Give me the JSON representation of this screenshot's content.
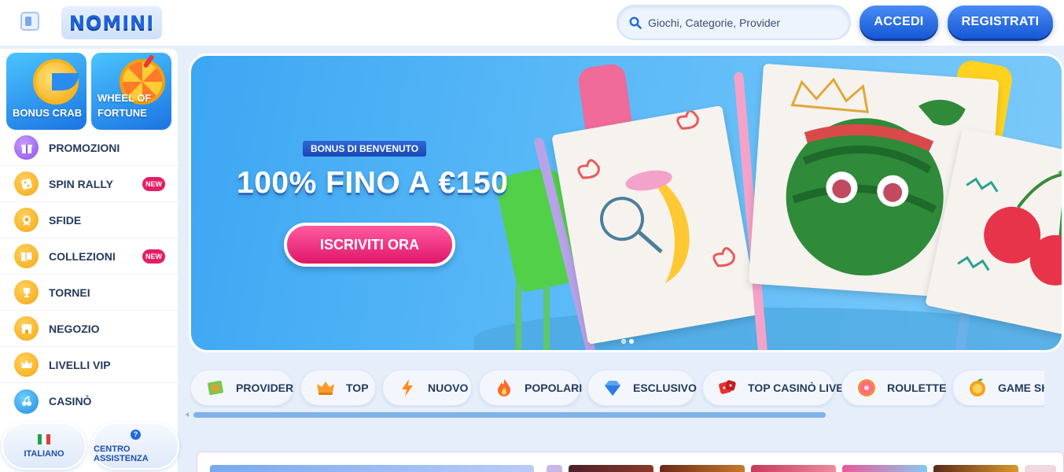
{
  "header": {
    "logo_text": "NOMINI",
    "search_placeholder": "Giochi, Categorie, Provider",
    "login_label": "ACCEDI",
    "register_label": "REGISTRATI"
  },
  "sidebar": {
    "tiles": [
      {
        "label": "BONUS CRAB"
      },
      {
        "label": "WHEEL OF FORTUNE"
      }
    ],
    "items": [
      {
        "label": "PROMOZIONI",
        "icon": "gift-icon",
        "badge": ""
      },
      {
        "label": "SPIN RALLY",
        "icon": "puzzle-icon",
        "badge": "NEW"
      },
      {
        "label": "SFIDE",
        "icon": "medal-icon",
        "badge": ""
      },
      {
        "label": "COLLEZIONI",
        "icon": "cards-icon",
        "badge": "NEW"
      },
      {
        "label": "TORNEI",
        "icon": "trophy-icon",
        "badge": ""
      },
      {
        "label": "NEGOZIO",
        "icon": "shop-icon",
        "badge": ""
      },
      {
        "label": "LIVELLI VIP",
        "icon": "crown-icon",
        "badge": ""
      },
      {
        "label": "CASINÒ",
        "icon": "cherry-icon",
        "badge": ""
      }
    ],
    "language_label": "ITALIANO",
    "help_label": "CENTRO ASSISTENZA"
  },
  "hero": {
    "tag": "BONUS DI BENVENUTO",
    "title": "100% FINO A €150",
    "cta_label": "ISCRIVITI ORA",
    "slides": 2,
    "active_slide": 2
  },
  "tabs": [
    {
      "label": "PROVIDER",
      "icon": "book-icon",
      "color": "#7cc84a"
    },
    {
      "label": "TOP",
      "icon": "crown-icon",
      "color": "#ff9a2a"
    },
    {
      "label": "NUOVO",
      "icon": "lightning-icon",
      "color": "#ff8a1c"
    },
    {
      "label": "POPOLARI",
      "icon": "fire-icon",
      "color": "#ff6a2a"
    },
    {
      "label": "ESCLUSIVO",
      "icon": "diamond-icon",
      "color": "#5aa4ff"
    },
    {
      "label": "TOP CASINÒ LIVE",
      "icon": "dice-icon",
      "color": "#e8322f"
    },
    {
      "label": "ROULETTE",
      "icon": "donut-icon",
      "color": "#f78a3a"
    },
    {
      "label": "GAME SHO",
      "icon": "orange-icon",
      "color": "#f9a11b"
    }
  ],
  "colors": {
    "brand_blue": "#1658d4",
    "cta_pink": "#e0166a",
    "badge_red": "#e61d64",
    "background": "#e6eefa"
  }
}
